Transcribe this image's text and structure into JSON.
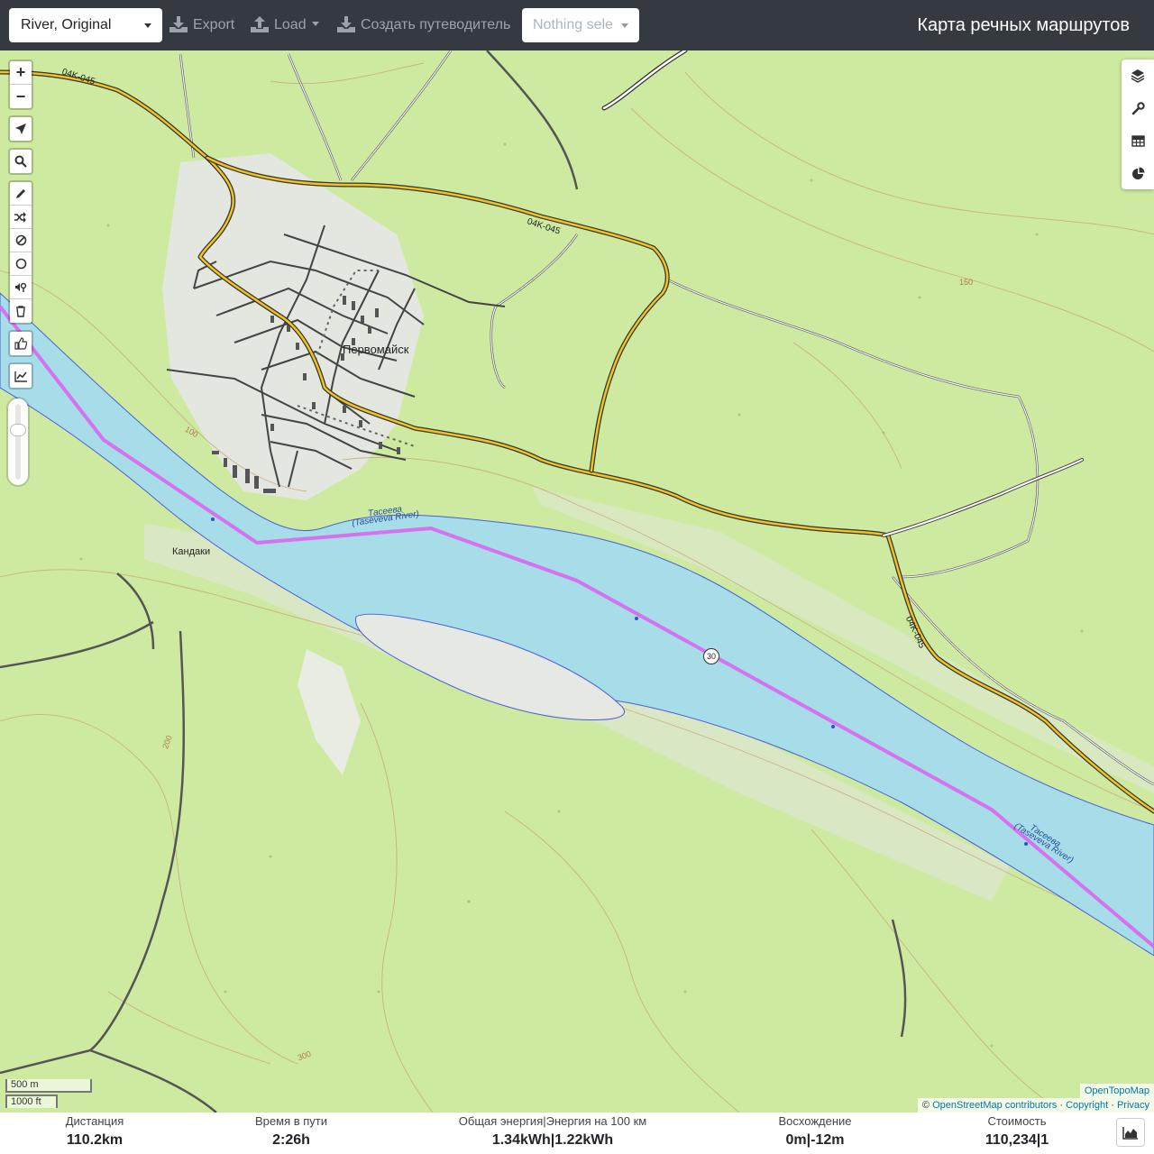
{
  "navbar": {
    "profile_select": "River, Original",
    "export_label": "Export",
    "load_label": "Load",
    "guide_label": "Создать путеводитель",
    "selection_placeholder": "Nothing sele",
    "brand": "Карта речных маршрутов"
  },
  "map": {
    "zoom_in": "+",
    "zoom_out": "−",
    "labels": {
      "town": "Первомайск",
      "village": "Кандаки",
      "road_ref_1": "04K-045",
      "road_ref_2": "04K-045",
      "road_ref_3": "04K-045",
      "river_name_1": "Тасеева",
      "river_name_1_en": "(Taseveva River)",
      "river_name_2": "Тасеева",
      "river_name_2_en": "(Taseveva River)",
      "route_marker": "30",
      "contour_100": "100",
      "contour_150": "150",
      "contour_200": "200",
      "contour_300": "300"
    },
    "scale": {
      "metric": "500 m",
      "imperial": "1000 ft"
    },
    "attribution": {
      "tile_source": "OpenTopoMap",
      "osm": "OpenStreetMap contributors",
      "prefix": "©",
      "copyright": "Copyright",
      "privacy": "Privacy",
      "sep": "·"
    }
  },
  "footer": {
    "distance_label": "Дистанция",
    "distance_value": "110.2",
    "distance_unit": "km",
    "time_label": "Время в пути",
    "time_value": "2:26",
    "time_unit": "h",
    "energy_label": "Общая энергия|Энергия на 100 км",
    "energy_total": "1.34",
    "energy_total_unit": "kWh",
    "energy_sep": "|",
    "energy_per100": "1.22",
    "energy_per100_unit": "kWh",
    "ascent_label": "Восхождение",
    "ascent_up": "0",
    "ascent_up_unit": "m",
    "ascent_sep": "|",
    "ascent_down": "-12",
    "ascent_down_unit": "m",
    "cost_label": "Стоимость",
    "cost_value": "110,234",
    "cost_sep": "|",
    "cost_count": "1"
  },
  "colors": {
    "navbar_bg": "#343a40",
    "forest": "#cdeaa0",
    "river": "#a6dde8",
    "route": "#d671f0",
    "road_primary": "#f2c41a"
  }
}
